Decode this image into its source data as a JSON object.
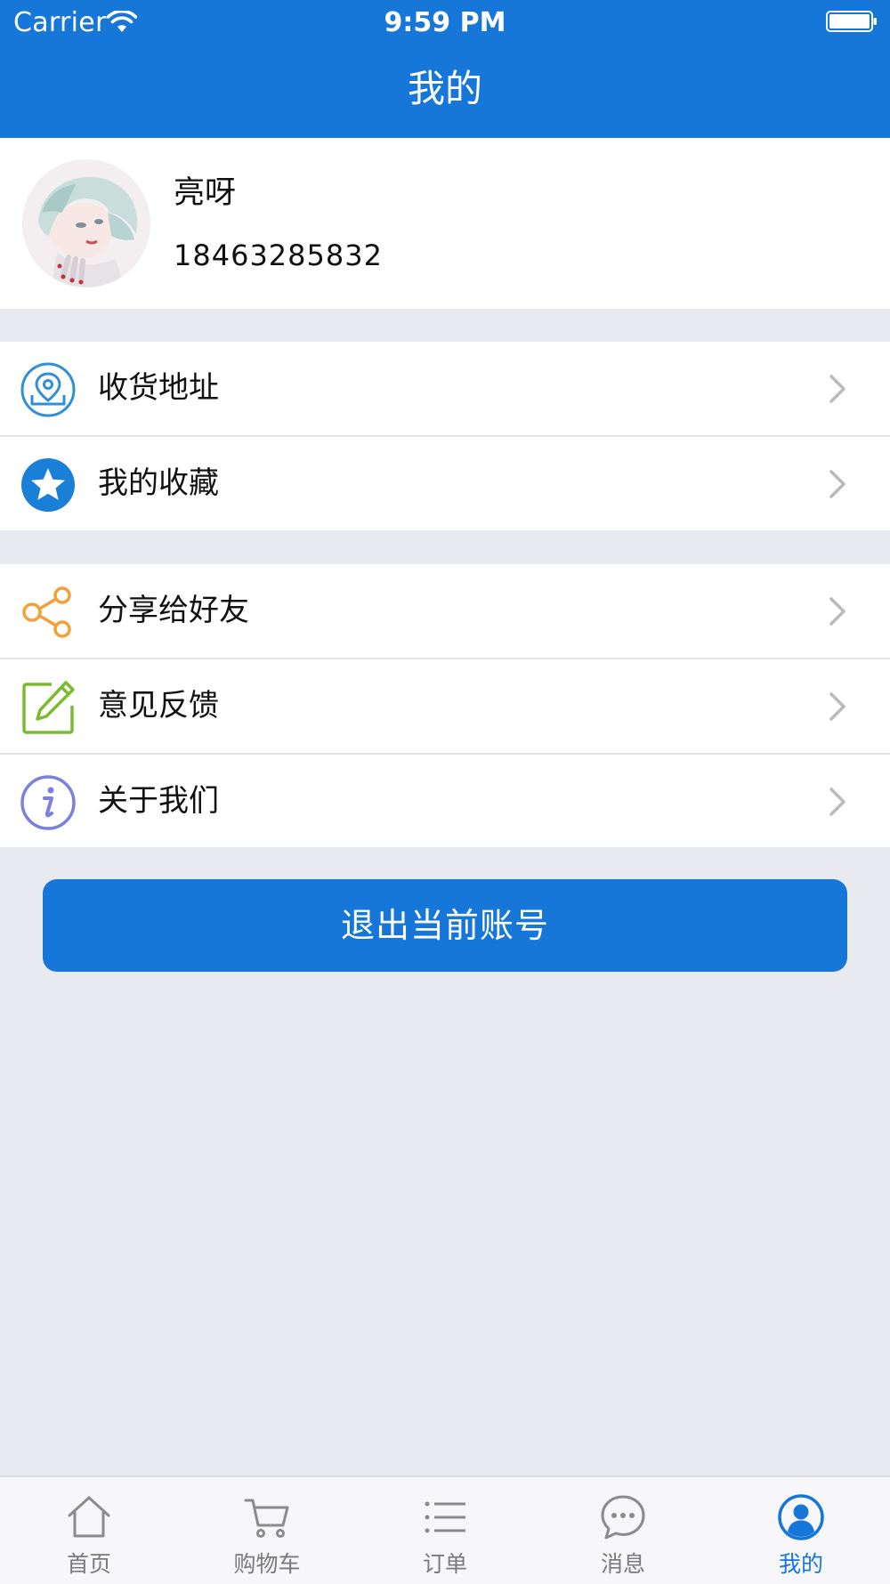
{
  "status_bar": {
    "carrier": "Carrier",
    "time": "9:59 PM"
  },
  "nav": {
    "title": "我的"
  },
  "profile": {
    "name": "亮呀",
    "phone": "18463285832"
  },
  "menu_group_1": [
    {
      "label": "收货地址",
      "icon": "location-pin-icon",
      "color": "#2f8fd8"
    },
    {
      "label": "我的收藏",
      "icon": "star-icon",
      "color": "#1a7fd6"
    }
  ],
  "menu_group_2": [
    {
      "label": "分享给好友",
      "icon": "share-icon",
      "color": "#f0a23a"
    },
    {
      "label": "意见反馈",
      "icon": "edit-icon",
      "color": "#7bbb2f"
    },
    {
      "label": "关于我们",
      "icon": "info-icon",
      "color": "#7b7fe0"
    }
  ],
  "logout": {
    "label": "退出当前账号"
  },
  "tabbar": {
    "active_index": 4,
    "items": [
      {
        "label": "首页",
        "icon": "home-icon"
      },
      {
        "label": "购物车",
        "icon": "cart-icon"
      },
      {
        "label": "订单",
        "icon": "list-icon"
      },
      {
        "label": "消息",
        "icon": "message-icon"
      },
      {
        "label": "我的",
        "icon": "user-icon"
      }
    ]
  },
  "colors": {
    "primary": "#1777d8",
    "background": "#e9e9f0",
    "tab_inactive": "#7a7a7a"
  }
}
